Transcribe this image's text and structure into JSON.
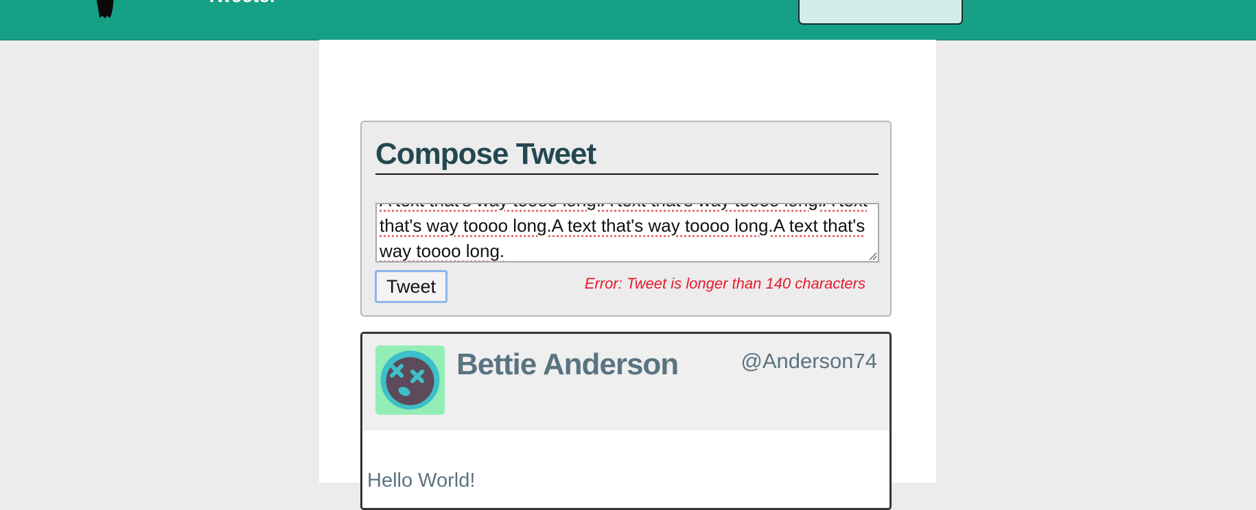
{
  "colors": {
    "navbar": "#16a085",
    "page_background": "#ececec",
    "heading": "#244751",
    "error": "#e8192c",
    "tweet_text": "#5a7381",
    "avatar_background": "#92eeb4"
  },
  "navbar": {
    "logo_icon": "bird-silhouette-icon",
    "brand": "Tweeter"
  },
  "compose": {
    "title": "Compose Tweet",
    "text": "A text that's way toooo long.A text that's way toooo long.A text that's way toooo long.A text that's way toooo long.A text that's way toooo long.",
    "button_label": "Tweet",
    "error": "Error: Tweet is longer than 140 characters"
  },
  "tweet": {
    "avatar_icon": "dizzy-face-icon",
    "name": "Bettie Anderson",
    "handle": "@Anderson74",
    "content": "Hello World!"
  }
}
